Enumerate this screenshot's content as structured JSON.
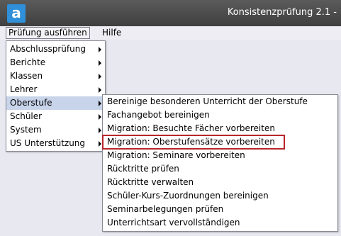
{
  "window": {
    "logo_letter": "a",
    "title": "Konsistenzprüfung 2.1 -"
  },
  "menubar": {
    "items": [
      {
        "label": "Prüfung ausführen"
      },
      {
        "label": "Hilfe"
      }
    ]
  },
  "main_menu": {
    "items": [
      {
        "label": "Abschlussprüfung"
      },
      {
        "label": "Berichte"
      },
      {
        "label": "Klassen"
      },
      {
        "label": "Lehrer"
      },
      {
        "label": "Oberstufe"
      },
      {
        "label": "Schüler"
      },
      {
        "label": "System"
      },
      {
        "label": "US Unterstützung"
      }
    ]
  },
  "sub_menu": {
    "items": [
      {
        "label": "Bereinige besonderen Unterricht der Oberstufe"
      },
      {
        "label": "Fachangebot bereinigen"
      },
      {
        "label": "Migration: Besuchte Fächer vorbereiten"
      },
      {
        "label": "Migration: Oberstufensätze vorbereiten"
      },
      {
        "label": "Migration: Seminare vorbereiten"
      },
      {
        "label": "Rücktritte prüfen"
      },
      {
        "label": "Rücktritte verwalten"
      },
      {
        "label": "Schüler-Kurs-Zuordnungen bereinigen"
      },
      {
        "label": "Seminarbelegungen prüfen"
      },
      {
        "label": "Unterrichtsart vervollständigen"
      }
    ]
  },
  "colors": {
    "accent_highlight": "#b8262a",
    "active_item_bg": "#c8d4ea",
    "logo": "#2f8fd8"
  }
}
